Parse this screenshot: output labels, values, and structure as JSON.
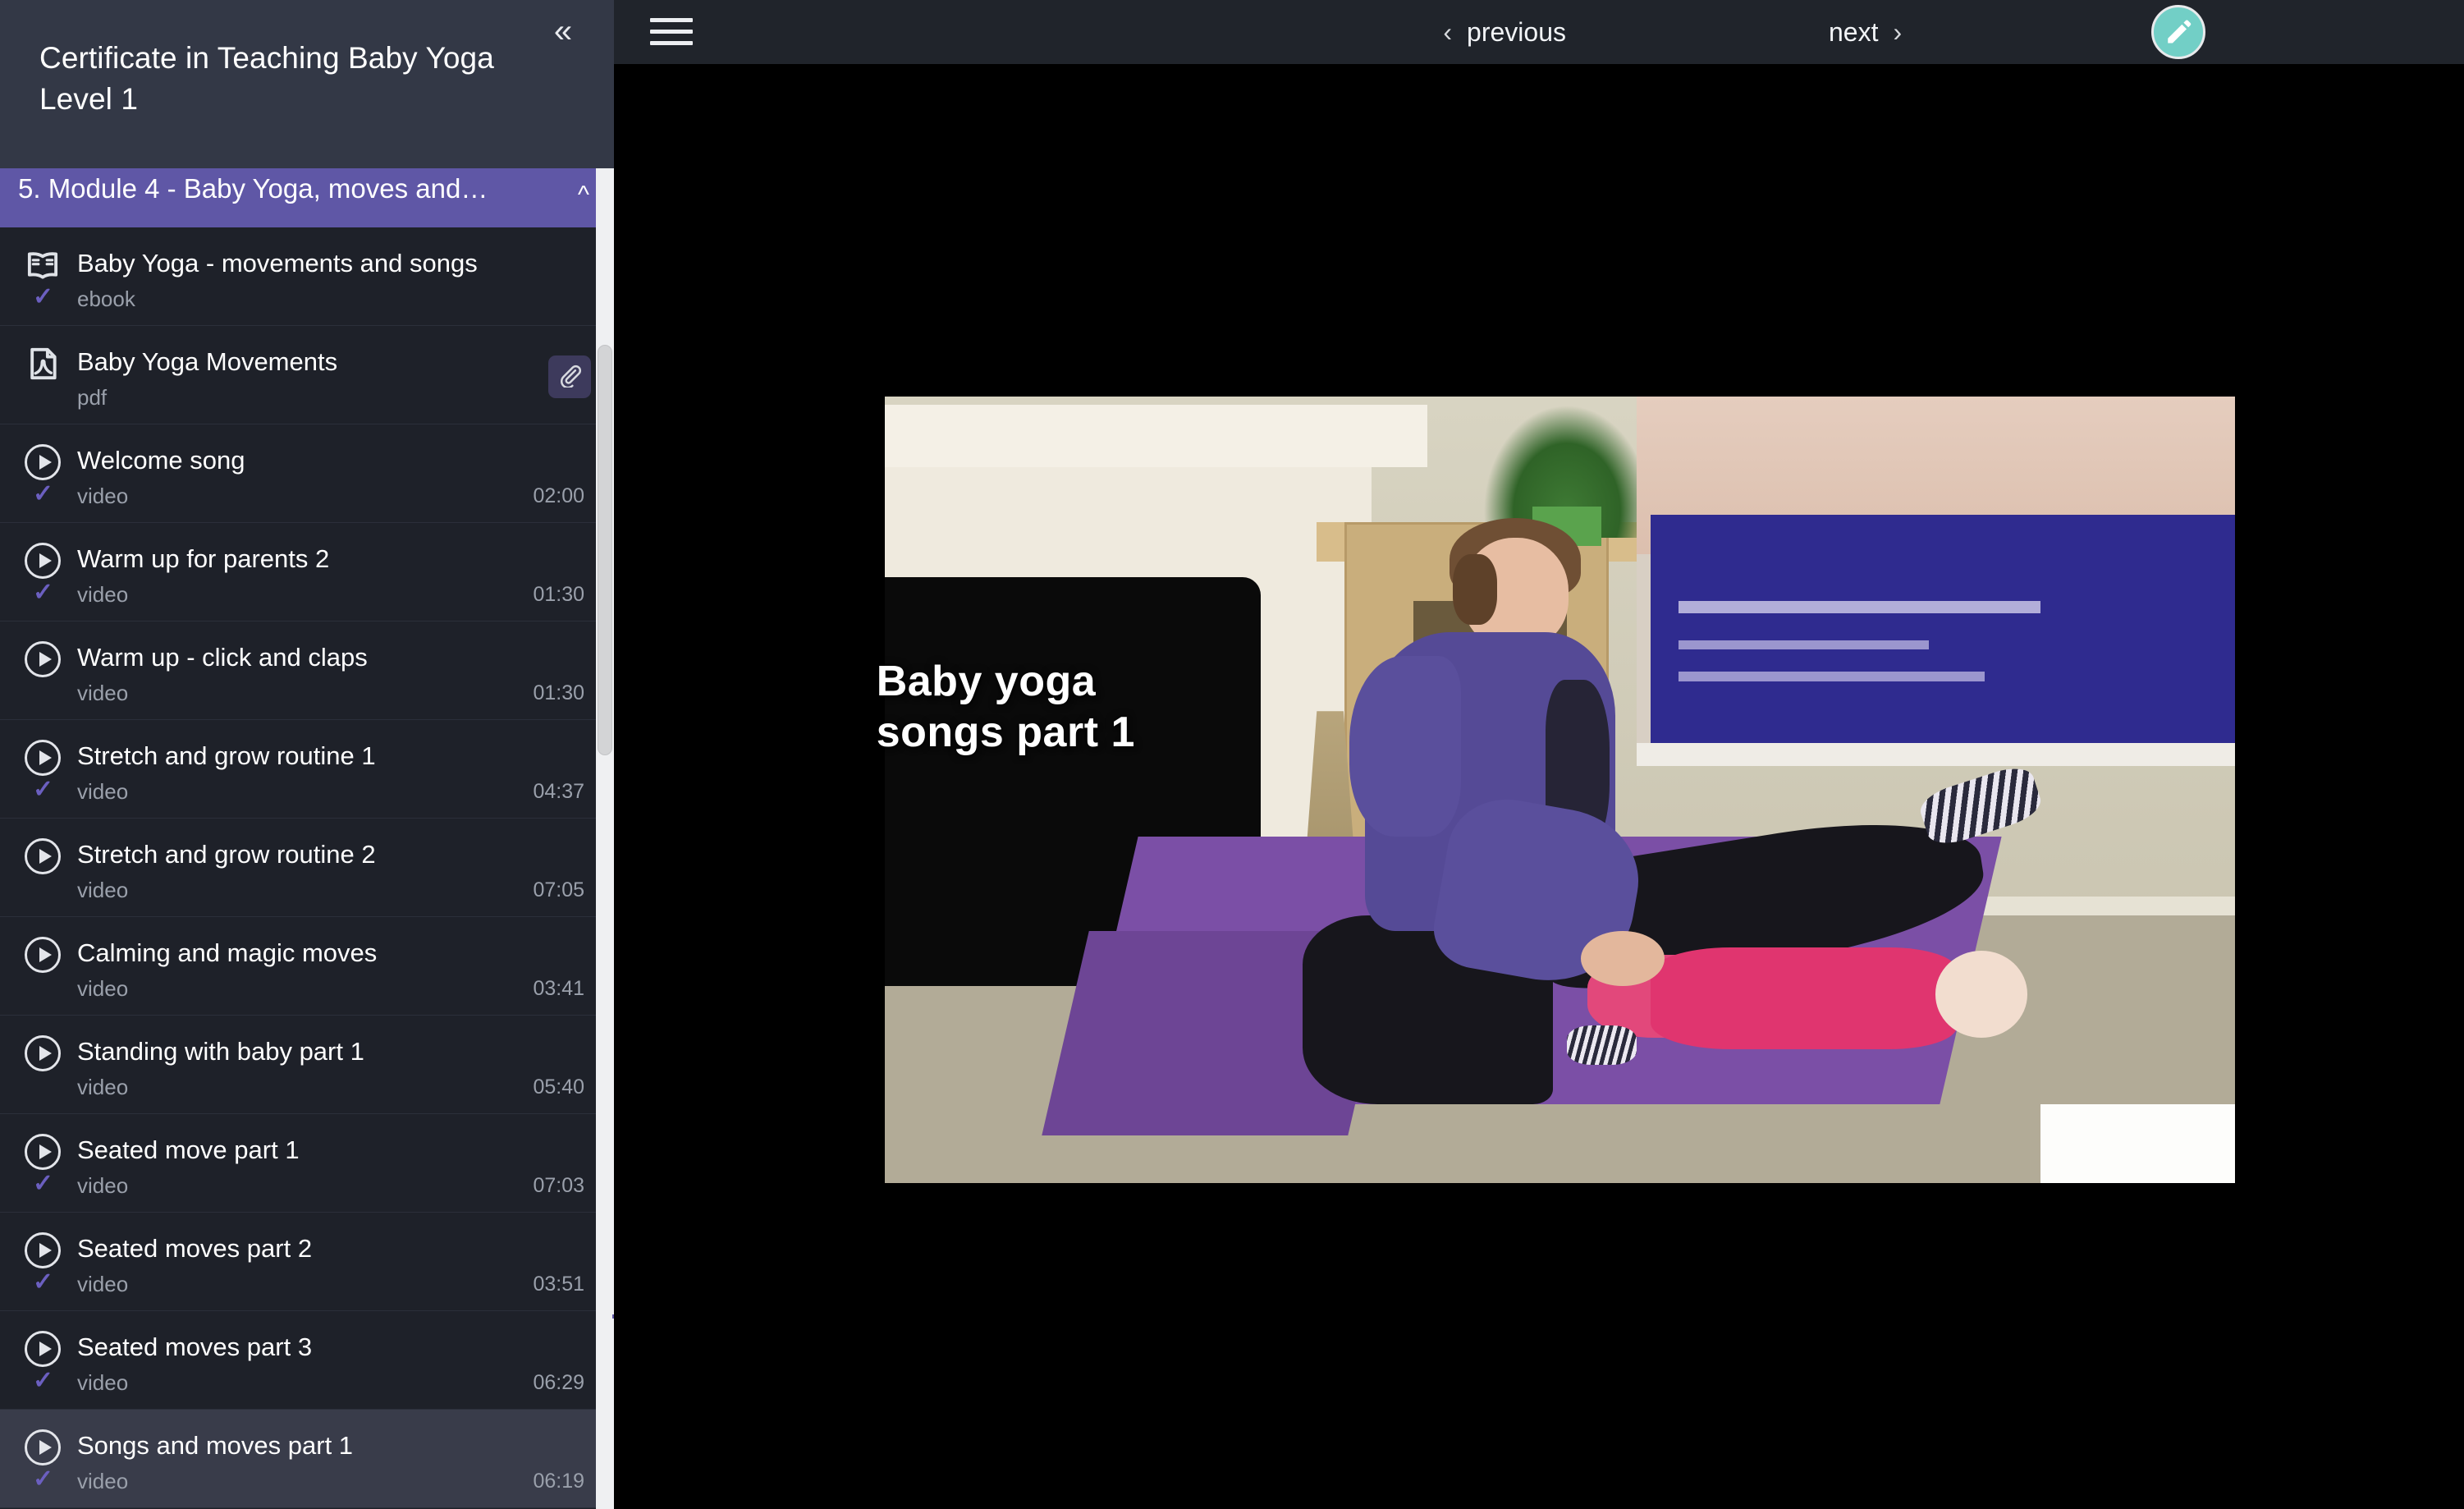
{
  "sidebar": {
    "course_title": "Certificate in Teaching Baby Yoga Level 1",
    "collapse_icon": "double-chevron-left-icon",
    "module": {
      "label": "5. Module 4 - Baby Yoga, moves and…",
      "chevron": "chevron-up-icon"
    },
    "lessons": [
      {
        "title": "Baby Yoga  - movements and songs",
        "type": "ebook",
        "duration": "",
        "icon": "book-icon",
        "completed": true,
        "attachment": false,
        "active": false
      },
      {
        "title": "Baby Yoga Movements",
        "type": "pdf",
        "duration": "",
        "icon": "pdf-icon",
        "completed": false,
        "attachment": true,
        "active": false
      },
      {
        "title": "Welcome song",
        "type": "video",
        "duration": "02:00",
        "icon": "play-icon",
        "completed": true,
        "attachment": false,
        "active": false
      },
      {
        "title": "Warm up for parents 2",
        "type": "video",
        "duration": "01:30",
        "icon": "play-icon",
        "completed": true,
        "attachment": false,
        "active": false
      },
      {
        "title": "Warm up -  click and claps",
        "type": "video",
        "duration": "01:30",
        "icon": "play-icon",
        "completed": false,
        "attachment": false,
        "active": false
      },
      {
        "title": "Stretch and grow routine 1",
        "type": "video",
        "duration": "04:37",
        "icon": "play-icon",
        "completed": true,
        "attachment": false,
        "active": false
      },
      {
        "title": "Stretch and grow routine 2",
        "type": "video",
        "duration": "07:05",
        "icon": "play-icon",
        "completed": false,
        "attachment": false,
        "active": false
      },
      {
        "title": "Calming and magic moves",
        "type": "video",
        "duration": "03:41",
        "icon": "play-icon",
        "completed": false,
        "attachment": false,
        "active": false
      },
      {
        "title": "Standing with baby part 1",
        "type": "video",
        "duration": "05:40",
        "icon": "play-icon",
        "completed": false,
        "attachment": false,
        "active": false
      },
      {
        "title": "Seated move part 1",
        "type": "video",
        "duration": "07:03",
        "icon": "play-icon",
        "completed": true,
        "attachment": false,
        "active": false
      },
      {
        "title": "Seated moves part 2",
        "type": "video",
        "duration": "03:51",
        "icon": "play-icon",
        "completed": true,
        "attachment": false,
        "active": false
      },
      {
        "title": "Seated moves part 3",
        "type": "video",
        "duration": "06:29",
        "icon": "play-icon",
        "completed": true,
        "attachment": false,
        "active": false
      },
      {
        "title": "Songs and moves part 1",
        "type": "video",
        "duration": "06:19",
        "icon": "play-icon",
        "completed": true,
        "attachment": false,
        "active": true
      }
    ]
  },
  "topbar": {
    "menu_icon": "hamburger-menu-icon",
    "previous_label": "previous",
    "previous_arrow": "chevron-left-icon",
    "next_label": "next",
    "next_arrow": "chevron-right-icon",
    "edit_icon": "pencil-icon"
  },
  "player": {
    "caption_line1": "Baby yoga",
    "caption_line2": "songs part 1"
  },
  "colors": {
    "sidebar_bg": "#1e2129",
    "sidebar_header_bg": "#333846",
    "module_purple": "#5f57a6",
    "accent_check": "#6b5fc0",
    "topbar_bg": "#20242b",
    "fab_teal": "#72cfc6",
    "active_row": "#393c4a"
  }
}
